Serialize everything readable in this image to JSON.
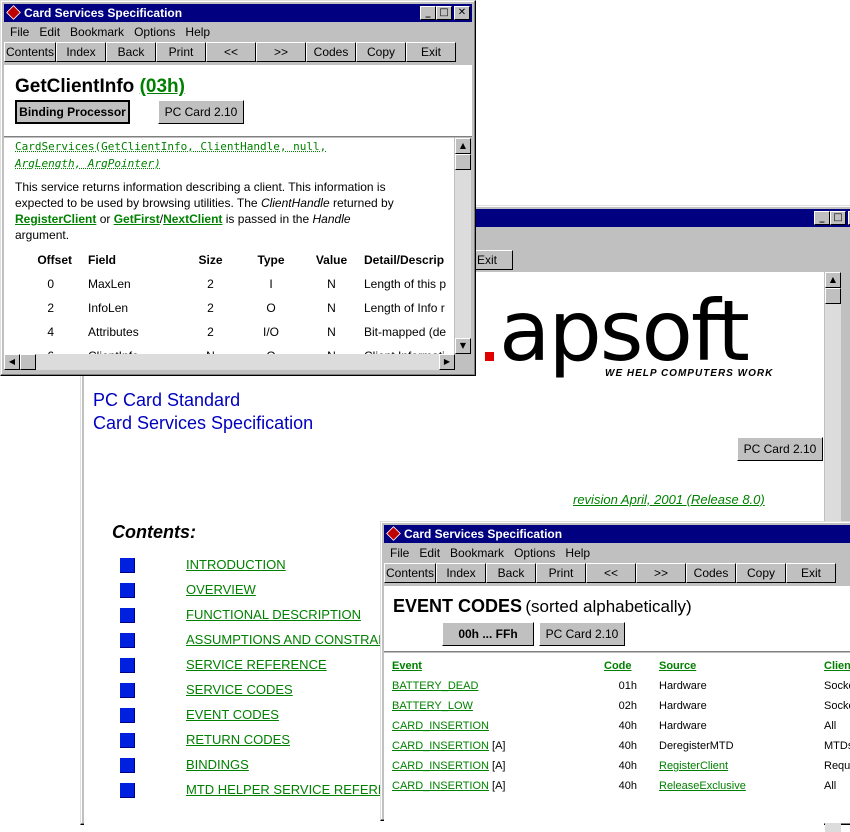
{
  "back_window": {
    "toolbar": {
      "exit": "Exit"
    },
    "logo": {
      "text": ".apsoft",
      "tagline": "WE HELP COMPUTERS WORK"
    },
    "heading1": "PC Card Standard",
    "heading2": "Card Services Specification",
    "pc_card_button": "PC Card 2.10",
    "revision": "revision April, 2001 (Release 8.0)",
    "contents_title": "Contents:",
    "toc": [
      "INTRODUCTION",
      "OVERVIEW",
      "FUNCTIONAL DESCRIPTION",
      "ASSUMPTIONS AND CONSTRAI",
      "SERVICE REFERENCE",
      "SERVICE CODES",
      "EVENT CODES",
      "RETURN CODES",
      "BINDINGS",
      "MTD HELPER SERVICE REFERE"
    ]
  },
  "top_window": {
    "title": "Card Services Specification",
    "menu": [
      "File",
      "Edit",
      "Bookmark",
      "Options",
      "Help"
    ],
    "toolbar": [
      "Contents",
      "Index",
      "Back",
      "Print",
      "<<",
      ">>",
      "Codes",
      "Copy",
      "Exit"
    ],
    "heading": "GetClientInfo",
    "code": "(03h)",
    "binding_button": "Binding Processor",
    "pc_card_button": "PC Card 2.10",
    "syntax_line1": "CardServices(GetClientInfo, ClientHandle, null,",
    "syntax_line2": "ArgLength, ArgPointer)",
    "desc1": "This service returns information describing a client. This information is",
    "desc2": "expected to be used by browsing utilities. The",
    "desc2_italic": "ClientHandle",
    "desc2_end": "returned by",
    "link_register": "RegisterClient",
    "desc3_or": "or",
    "link_getfirst": "GetFirst",
    "slash": "/",
    "link_nextclient": "NextClient",
    "desc3_mid": "is passed in the",
    "desc3_italic": "Handle",
    "desc4": "argument.",
    "columns": [
      "Offset",
      "Field",
      "Size",
      "Type",
      "Value",
      "Detail/Descrip"
    ],
    "rows": [
      [
        "0",
        "MaxLen",
        "2",
        "I",
        "N",
        "Length of this p"
      ],
      [
        "2",
        "InfoLen",
        "2",
        "O",
        "N",
        "Length of Info r"
      ],
      [
        "4",
        "Attributes",
        "2",
        "I/O",
        "N",
        "Bit-mapped (de"
      ],
      [
        "6",
        "ClientInfo",
        "N",
        "O",
        "N",
        "Client Informati"
      ]
    ]
  },
  "bottom_window": {
    "title": "Card Services Specification",
    "menu": [
      "File",
      "Edit",
      "Bookmark",
      "Options",
      "Help"
    ],
    "toolbar": [
      "Contents",
      "Index",
      "Back",
      "Print",
      "<<",
      ">>",
      "Codes",
      "Copy",
      "Exit"
    ],
    "heading": "EVENT CODES",
    "heading_suffix": "(sorted alphabetically)",
    "range_button": "00h ... FFh",
    "pc_card_button": "PC Card 2.10",
    "columns": [
      "Event",
      "Code",
      "Source",
      "Clien"
    ],
    "rows": [
      {
        "event": "BATTERY_DEAD",
        "suffix": "",
        "code": "01h",
        "source": "Hardware",
        "source_link": false,
        "client": "Socke"
      },
      {
        "event": "BATTERY_LOW",
        "suffix": "",
        "code": "02h",
        "source": "Hardware",
        "source_link": false,
        "client": "Socke"
      },
      {
        "event": "CARD_INSERTION",
        "suffix": "",
        "code": "40h",
        "source": "Hardware",
        "source_link": false,
        "client": "All"
      },
      {
        "event": "CARD_INSERTION",
        "suffix": " [A]",
        "code": "40h",
        "source": "DeregisterMTD",
        "source_link": false,
        "client": "MTDs"
      },
      {
        "event": "CARD_INSERTION",
        "suffix": " [A]",
        "code": "40h",
        "source": "RegisterClient",
        "source_link": true,
        "client": "Reque"
      },
      {
        "event": "CARD_INSERTION",
        "suffix": " [A]",
        "code": "40h",
        "source": "ReleaseExclusive",
        "source_link": true,
        "client": "All"
      }
    ]
  }
}
